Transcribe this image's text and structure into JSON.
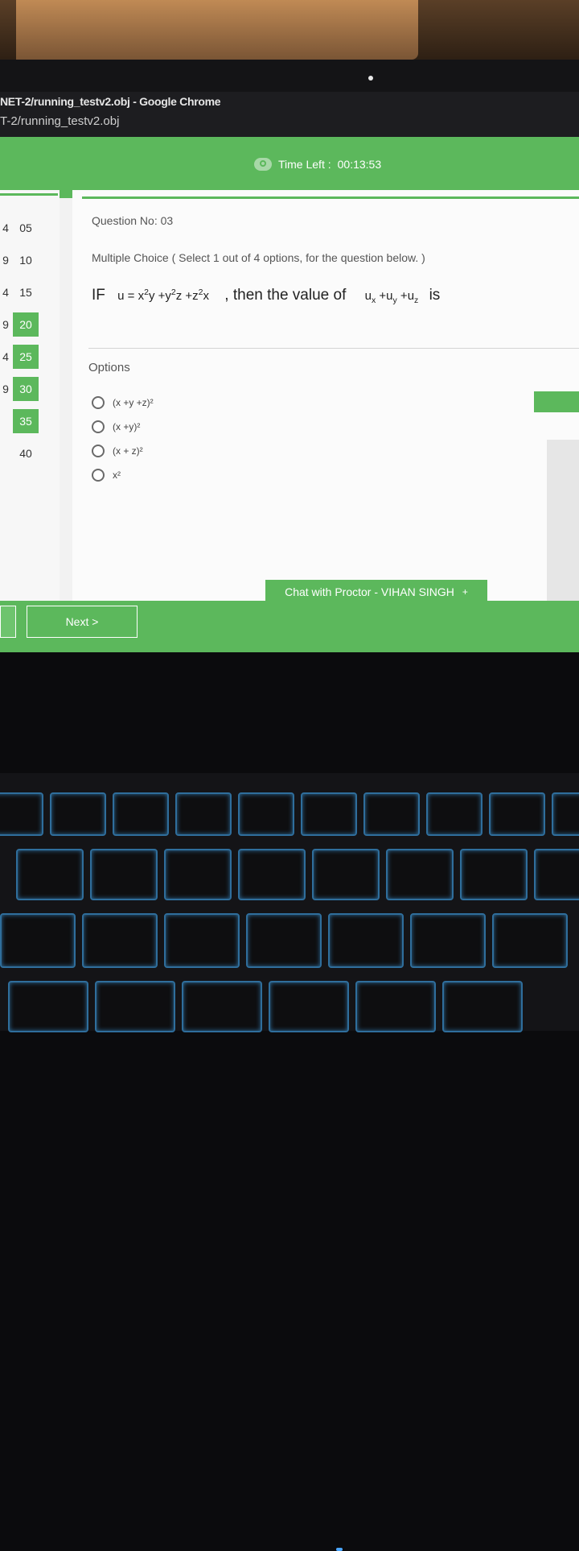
{
  "browser": {
    "window_title": "NET-2/running_testv2.obj - Google Chrome",
    "tab_title": "T-2/running_testv2.obj"
  },
  "header": {
    "timer_label": "Time Left :",
    "timer_value": "00:13:53",
    "timer_icon": "clock-icon"
  },
  "sidebar": {
    "items": [
      {
        "pre": "4",
        "num": "05"
      },
      {
        "pre": "9",
        "num": "10"
      },
      {
        "pre": "4",
        "num": "15"
      },
      {
        "pre": "9",
        "num": "20"
      },
      {
        "pre": "4",
        "num": "25"
      },
      {
        "pre": "9",
        "num": "30"
      },
      {
        "pre": "",
        "num": "35"
      },
      {
        "pre": "",
        "num": "40"
      }
    ]
  },
  "question": {
    "number_label": "Question No: 03",
    "type_label": "Multiple Choice ( Select 1 out of 4 options, for the question below. )",
    "text_if": "IF",
    "text_then": ", then the value of",
    "text_is": "is"
  },
  "options": {
    "heading": "Options",
    "items": [
      "(x +y +z)²",
      "(x +y)²",
      "(x + z)²",
      "x²"
    ]
  },
  "chat": {
    "label": "Chat with Proctor - VIHAN SINGH",
    "icon": "+"
  },
  "footer": {
    "next_label": "Next >"
  },
  "colors": {
    "accent": "#5cb85c"
  }
}
